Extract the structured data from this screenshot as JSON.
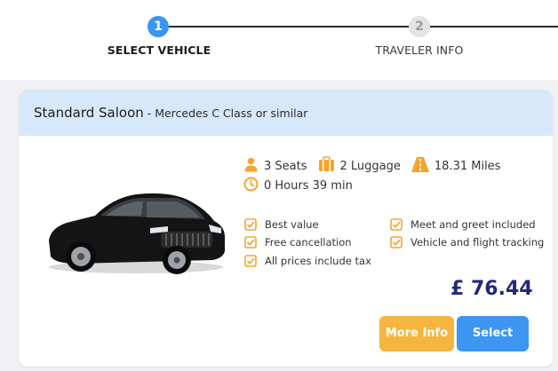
{
  "stepper": {
    "steps": [
      {
        "number": "1",
        "label": "SELECT VEHICLE",
        "state": "active"
      },
      {
        "number": "2",
        "label": "TRAVELER INFO",
        "state": "inactive"
      }
    ]
  },
  "vehicle": {
    "title": "Standard Saloon",
    "subtitle": " - Mercedes C Class or similar",
    "specs": {
      "seats": "3 Seats",
      "luggage": "2 Luggage",
      "distance": "18.31 Miles",
      "duration": "0 Hours 39 min"
    },
    "features": [
      "Best value",
      "Meet and greet included",
      "Free cancellation",
      "Vehicle and flight tracking",
      "All prices include tax"
    ],
    "price": "£ 76.44"
  },
  "actions": {
    "more_info_label": "More Info",
    "select_label": "Select"
  },
  "colors": {
    "accent_blue": "#3b94f0",
    "accent_orange": "#f5b63f",
    "price_navy": "#23297a",
    "header_bg": "#d8e8fb"
  },
  "icons": {
    "seats": "person-icon",
    "luggage": "suitcase-icon",
    "distance": "road-icon",
    "duration": "clock-icon",
    "feature": "checkbox-checked-icon"
  }
}
